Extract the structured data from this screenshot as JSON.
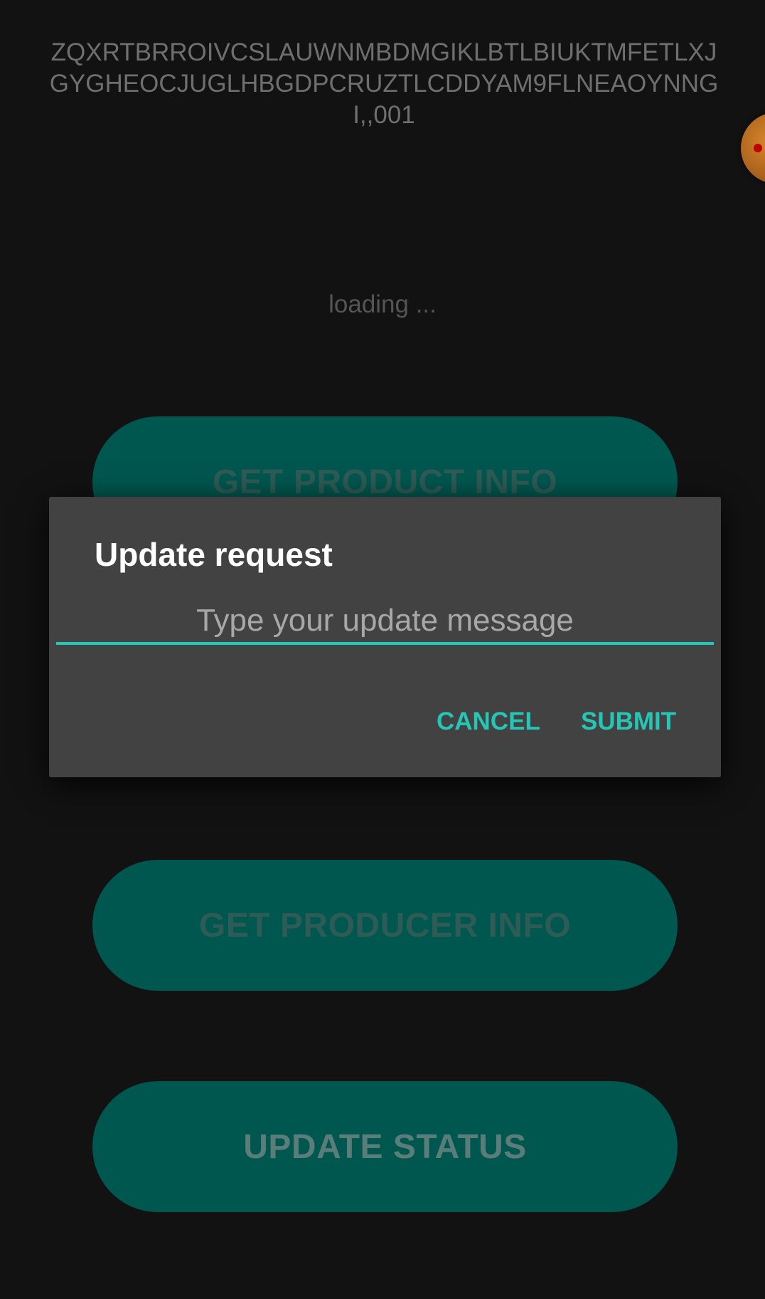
{
  "header": {
    "product_id": "ZQXRTBRROIVCSLAUWNMBDMGIKLBTLBIUKTMFETLXJGYGHEOCJUGLHBGDPCRUZTLCDDYAM9FLNEAOYNNGI,,001"
  },
  "status": {
    "loading_text": "loading ..."
  },
  "actions": {
    "get_product_info": "GET PRODUCT INFO",
    "get_producer_info": "GET PRODUCER INFO",
    "update_status": "UPDATE STATUS"
  },
  "dialog": {
    "title": "Update request",
    "input_placeholder": "Type your update message",
    "input_value": "",
    "cancel_label": "CANCEL",
    "submit_label": "SUBMIT"
  },
  "colors": {
    "accent": "#26c6b6",
    "button_background": "#00574f",
    "dialog_background": "#424242",
    "screen_background": "#121212"
  },
  "icons": {
    "floating_bubble": "floating-bubble-icon"
  }
}
